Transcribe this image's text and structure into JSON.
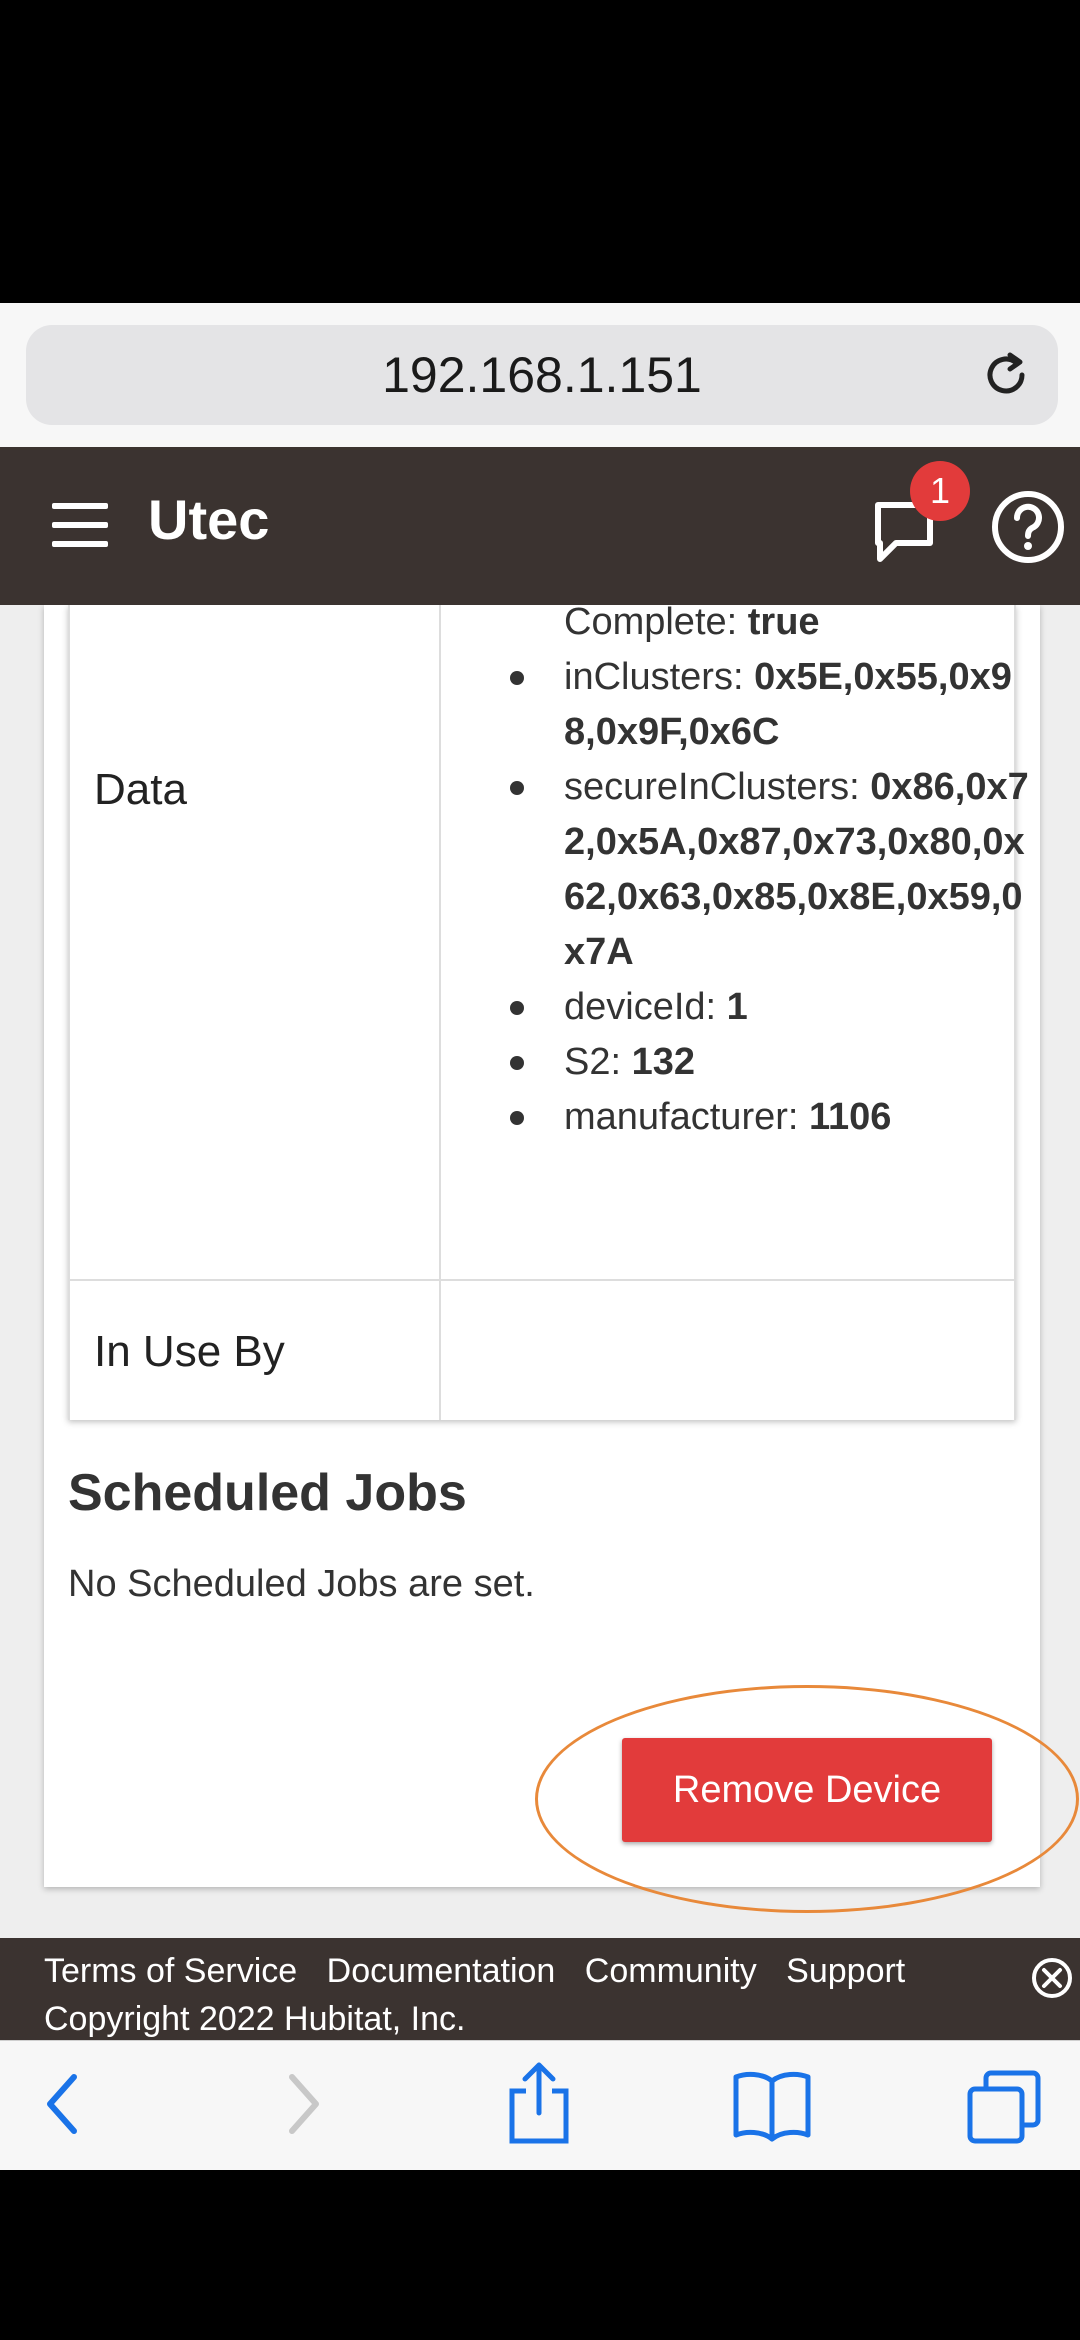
{
  "browser": {
    "url": "192.168.1.151"
  },
  "header": {
    "title": "Utec",
    "notification_count": "1"
  },
  "table": {
    "data_label": "Data",
    "data_items": [
      {
        "key": "Complete: ",
        "value": "true",
        "bullet": false
      },
      {
        "key": "inClusters: ",
        "value": "0x5E,0x55,0x98,0x9F,0x6C",
        "bullet": true
      },
      {
        "key": "secureInClusters: ",
        "value": "0x86,0x72,0x5A,0x87,0x73,0x80,0x62,0x63,0x85,0x8E,0x59,0x7A",
        "bullet": true
      },
      {
        "key": "deviceId: ",
        "value": "1",
        "bullet": true
      },
      {
        "key": "S2: ",
        "value": "132",
        "bullet": true
      },
      {
        "key": "manufacturer: ",
        "value": "1106",
        "bullet": true
      }
    ],
    "in_use_label": "In Use By"
  },
  "scheduled": {
    "title": "Scheduled Jobs",
    "text": "No Scheduled Jobs are set."
  },
  "remove_button": "Remove Device",
  "footer": {
    "links": [
      "Terms of Service",
      "Documentation",
      "Community",
      "Support"
    ],
    "copyright": "Copyright 2022 Hubitat, Inc."
  },
  "colors": {
    "header_bg": "#3b3330",
    "danger": "#e23b3b",
    "highlight": "#e8893a"
  }
}
